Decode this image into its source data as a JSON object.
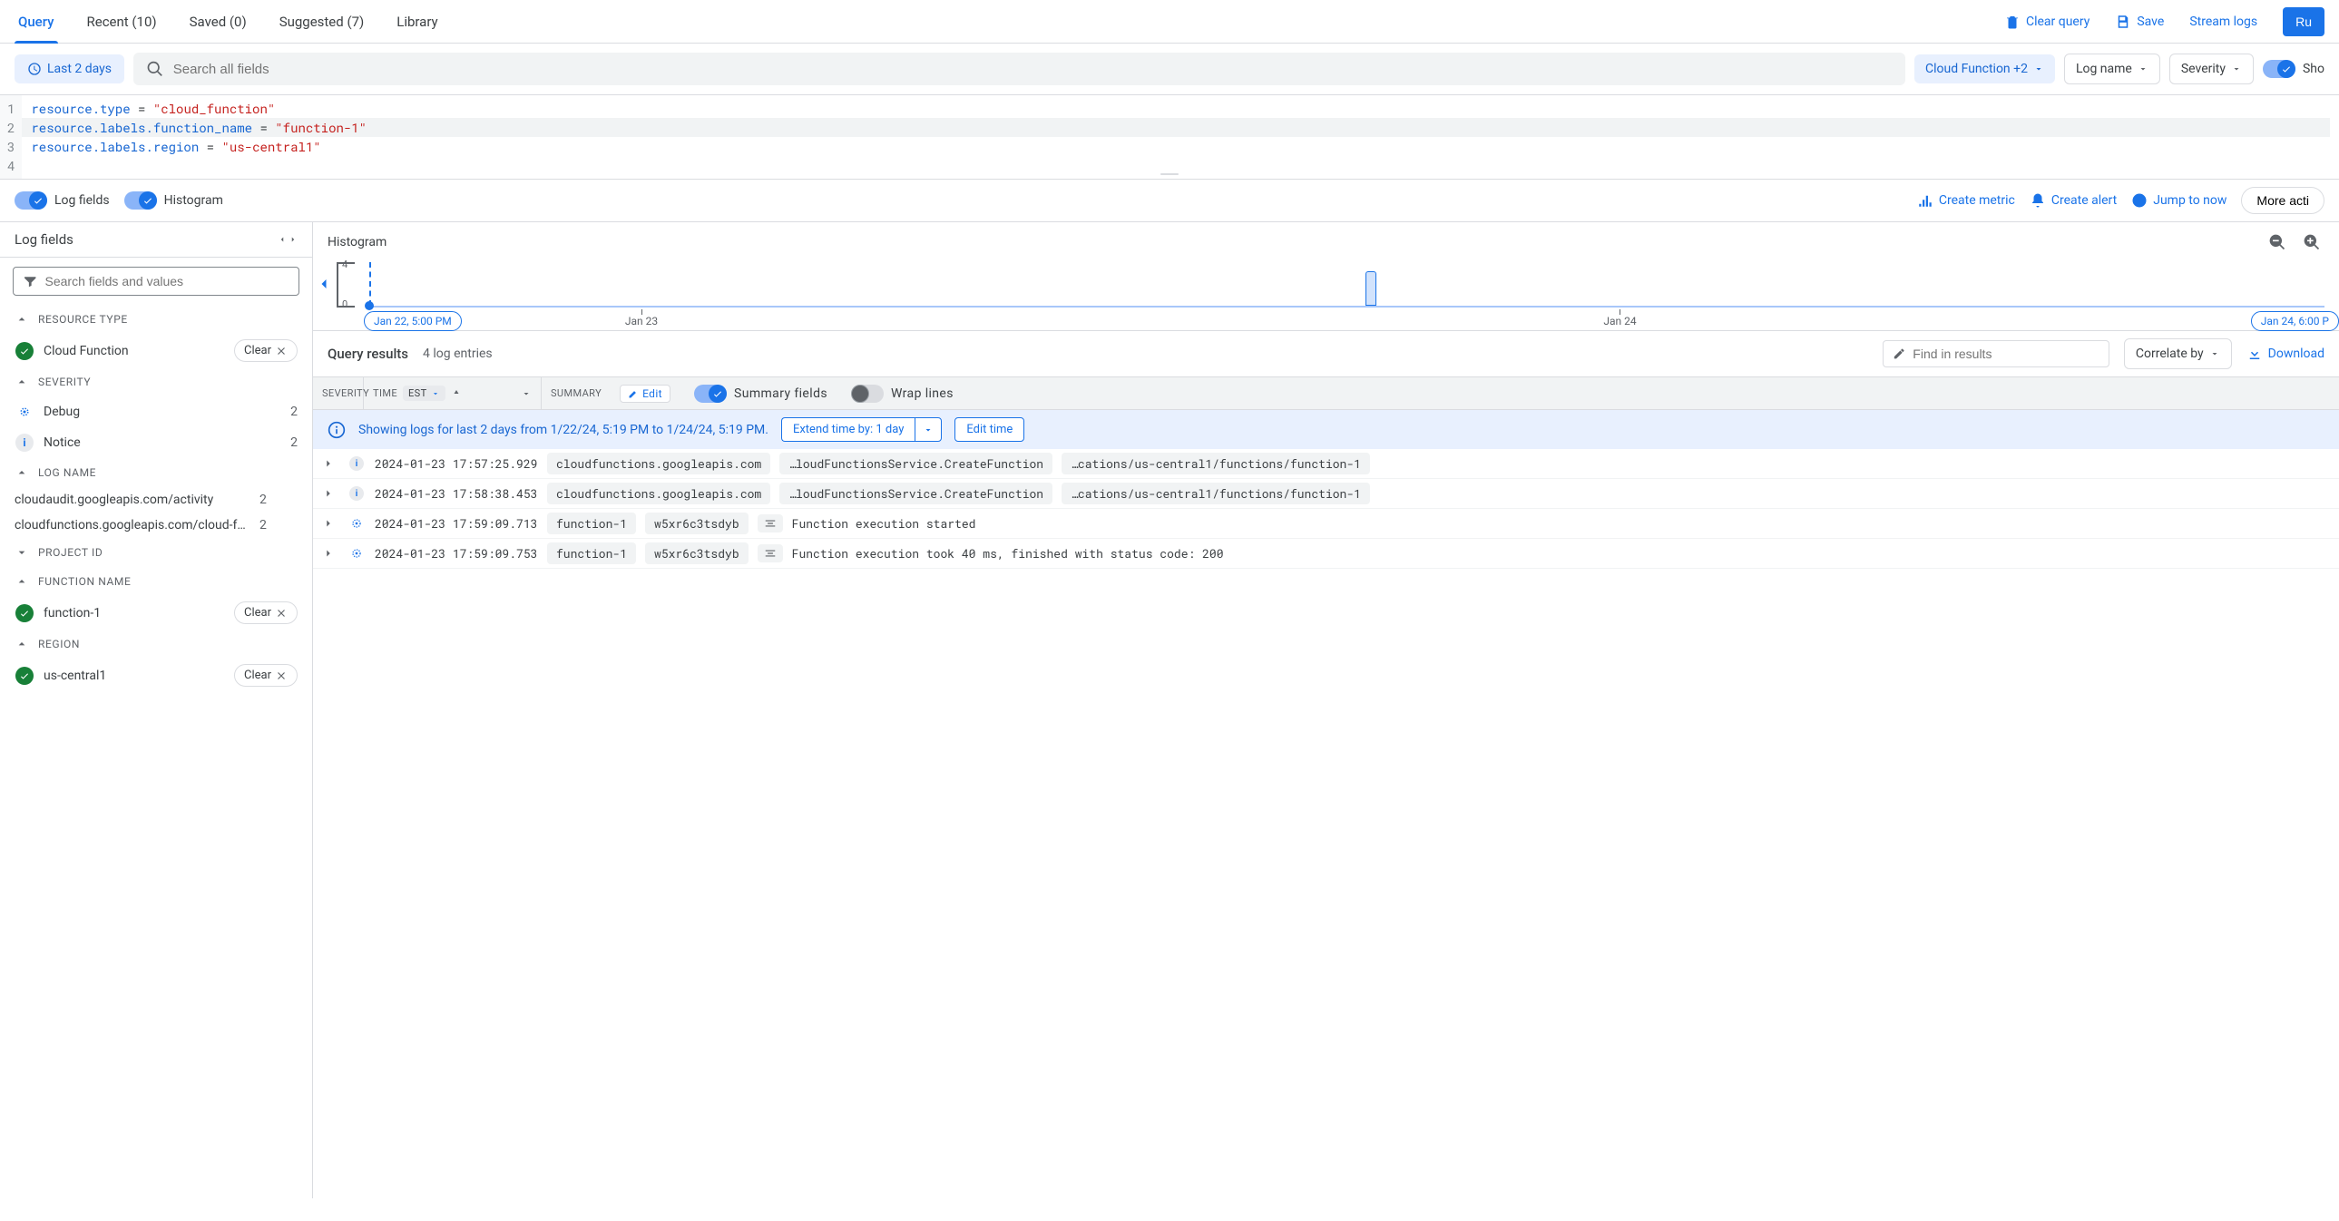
{
  "tabs": {
    "query": "Query",
    "recent": "Recent (10)",
    "saved": "Saved (0)",
    "suggested": "Suggested (7)",
    "library": "Library"
  },
  "top_actions": {
    "clear_query": "Clear query",
    "save": "Save",
    "stream_logs": "Stream logs",
    "run": "Ru"
  },
  "filter_bar": {
    "time_range": "Last 2 days",
    "search_placeholder": "Search all fields",
    "resource_filter": "Cloud Function +2",
    "log_name": "Log name",
    "severity": "Severity",
    "show_toggle": "Sho"
  },
  "editor": {
    "lines": [
      {
        "n": "1",
        "tokens": [
          [
            "kw",
            "resource.type"
          ],
          [
            "op",
            " = "
          ],
          [
            "str",
            "\"cloud_function\""
          ]
        ]
      },
      {
        "n": "2",
        "tokens": [
          [
            "kw",
            "resource.labels.function_name"
          ],
          [
            "op",
            " = "
          ],
          [
            "str",
            "\"function-1\""
          ]
        ],
        "hl": true
      },
      {
        "n": "3",
        "tokens": [
          [
            "kw",
            "resource.labels.region"
          ],
          [
            "op",
            " = "
          ],
          [
            "str",
            "\"us-central1\""
          ]
        ]
      },
      {
        "n": "4",
        "tokens": []
      }
    ]
  },
  "toggle_bar": {
    "log_fields": "Log fields",
    "histogram": "Histogram",
    "create_metric": "Create metric",
    "create_alert": "Create alert",
    "jump_now": "Jump to now",
    "more": "More acti"
  },
  "sidebar": {
    "title": "Log fields",
    "search_placeholder": "Search fields and values",
    "clear_label": "Clear",
    "sections": {
      "resource_type": {
        "label": "RESOURCE TYPE",
        "items": [
          {
            "name": "Cloud Function",
            "clear": true
          }
        ]
      },
      "severity": {
        "label": "SEVERITY",
        "items": [
          {
            "name": "Debug",
            "count": "2"
          },
          {
            "name": "Notice",
            "count": "2"
          }
        ]
      },
      "log_name": {
        "label": "LOG NAME",
        "items": [
          {
            "name": "cloudaudit.googleapis.com/activity",
            "count": "2"
          },
          {
            "name": "cloudfunctions.googleapis.com/cloud-func…",
            "count": "2"
          }
        ]
      },
      "project_id": {
        "label": "PROJECT ID"
      },
      "function_name": {
        "label": "FUNCTION NAME",
        "items": [
          {
            "name": "function-1",
            "clear": true
          }
        ]
      },
      "region": {
        "label": "REGION",
        "items": [
          {
            "name": "us-central1",
            "clear": true
          }
        ]
      }
    }
  },
  "histogram": {
    "title": "Histogram",
    "y_top": "4",
    "y_bot": "0",
    "start_chip": "Jan 22, 5:00 PM",
    "end_chip": "Jan 24, 6:00 P",
    "x_labels": [
      "Jan 23",
      "Jan 24"
    ]
  },
  "results": {
    "title": "Query results",
    "count": "4 log entries",
    "find_placeholder": "Find in results",
    "correlate": "Correlate by",
    "download": "Download"
  },
  "col_header": {
    "severity": "SEVERITY",
    "time": "TIME",
    "tz": "EST",
    "summary": "SUMMARY",
    "edit": "Edit",
    "summary_fields": "Summary fields",
    "wrap_lines": "Wrap lines"
  },
  "banner": {
    "msg": "Showing logs for last 2 days from 1/22/24, 5:19 PM to 1/24/24, 5:19 PM.",
    "extend": "Extend time by: 1 day",
    "edit_time": "Edit time"
  },
  "logs": [
    {
      "sev": "info",
      "ts": "2024-01-23 17:57:25.929",
      "pills": [
        "cloudfunctions.googleapis.com",
        "…loudFunctionsService.CreateFunction",
        "…cations/us-central1/functions/function-1"
      ]
    },
    {
      "sev": "info",
      "ts": "2024-01-23 17:58:38.453",
      "pills": [
        "cloudfunctions.googleapis.com",
        "…loudFunctionsService.CreateFunction",
        "…cations/us-central1/functions/function-1"
      ]
    },
    {
      "sev": "debug",
      "ts": "2024-01-23 17:59:09.713",
      "pills": [
        "function-1",
        "w5xr6c3tsdyb"
      ],
      "icon": true,
      "msg": "Function execution started"
    },
    {
      "sev": "debug",
      "ts": "2024-01-23 17:59:09.753",
      "pills": [
        "function-1",
        "w5xr6c3tsdyb"
      ],
      "icon": true,
      "msg": "Function execution took 40 ms, finished with status code: 200"
    }
  ],
  "chart_data": {
    "type": "bar",
    "title": "Histogram",
    "ylabel": "",
    "ylim": [
      0,
      4
    ],
    "x_range": [
      "Jan 22, 5:00 PM",
      "Jan 24, 6:00 PM"
    ],
    "categories": [
      "Jan 23 ~18:00"
    ],
    "values": [
      4
    ]
  }
}
